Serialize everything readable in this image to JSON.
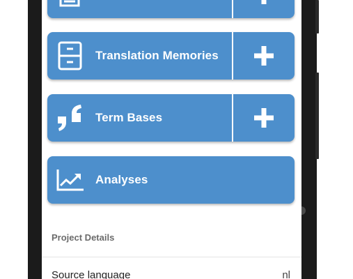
{
  "tiles": [
    {
      "id": "top",
      "label": "",
      "icon": "document-icon",
      "has_add": true
    },
    {
      "id": "translation-memories",
      "label": "Translation Memories",
      "icon": "file-cabinet-icon",
      "has_add": true
    },
    {
      "id": "term-bases",
      "label": "Term Bases",
      "icon": "quote-icon",
      "has_add": true
    },
    {
      "id": "analyses",
      "label": "Analyses",
      "icon": "chart-line-icon",
      "has_add": false
    }
  ],
  "project_details": {
    "heading": "Project Details",
    "rows": [
      {
        "label": "Source language",
        "value": "nl"
      }
    ]
  },
  "colors": {
    "tile_blue": "#4d8fcc",
    "frame": "#1b1b1b"
  }
}
